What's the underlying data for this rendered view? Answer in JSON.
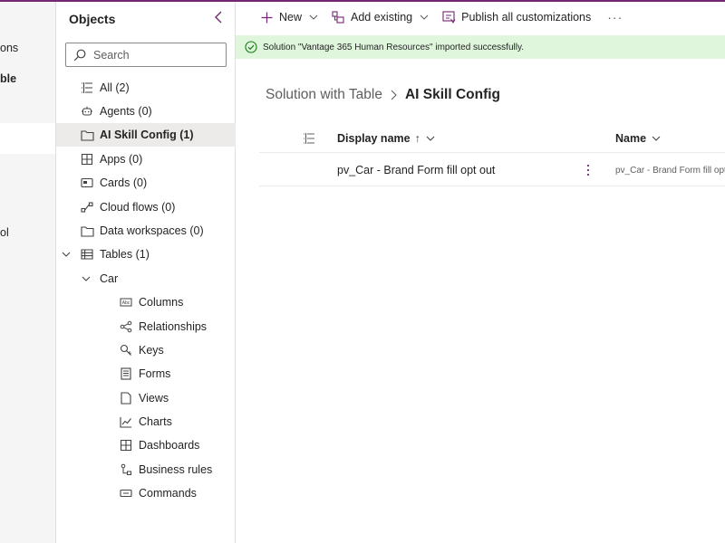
{
  "left_nav": {
    "items": [
      {
        "label": "ons",
        "bold": false
      },
      {
        "label": "ble",
        "bold": true
      },
      {
        "label": "ol",
        "bold": false
      }
    ]
  },
  "objects": {
    "title": "Objects",
    "search_placeholder": "Search",
    "items": [
      {
        "label": "All",
        "count": "(2)",
        "icon": "list-icon"
      },
      {
        "label": "Agents",
        "count": "(0)",
        "icon": "bot-icon"
      },
      {
        "label": "AI Skill Config",
        "count": "(1)",
        "icon": "folder-icon",
        "selected": true
      },
      {
        "label": "Apps",
        "count": "(0)",
        "icon": "apps-icon"
      },
      {
        "label": "Cards",
        "count": "(0)",
        "icon": "card-icon"
      },
      {
        "label": "Cloud flows",
        "count": "(0)",
        "icon": "flow-icon"
      },
      {
        "label": "Data workspaces",
        "count": "(0)",
        "icon": "folder-icon"
      },
      {
        "label": "Tables",
        "count": "(1)",
        "icon": "table-icon",
        "expanded": true
      },
      {
        "label": "Car",
        "count": "",
        "icon": "",
        "expanded": true
      }
    ],
    "car_children": [
      {
        "label": "Columns",
        "icon": "columns-icon"
      },
      {
        "label": "Relationships",
        "icon": "relationships-icon"
      },
      {
        "label": "Keys",
        "icon": "key-icon"
      },
      {
        "label": "Forms",
        "icon": "form-icon"
      },
      {
        "label": "Views",
        "icon": "view-icon"
      },
      {
        "label": "Charts",
        "icon": "chart-icon"
      },
      {
        "label": "Dashboards",
        "icon": "dashboard-icon"
      },
      {
        "label": "Business rules",
        "icon": "business-rules-icon"
      },
      {
        "label": "Commands",
        "icon": "command-icon"
      }
    ]
  },
  "toolbar": {
    "new_label": "New",
    "add_existing_label": "Add existing",
    "publish_label": "Publish all customizations",
    "more_label": "···"
  },
  "banner": {
    "text": "Solution \"Vantage 365 Human Resources\" imported successfully.",
    "status_color": "#107c10"
  },
  "breadcrumb": {
    "parent": "Solution with Table",
    "current": "AI Skill Config"
  },
  "grid": {
    "columns": {
      "display_name": "Display name",
      "sort_indicator": "↑",
      "name": "Name"
    },
    "rows": [
      {
        "display_name": "pv_Car - Brand Form fill opt out",
        "name": "pv_Car - Brand Form fill opt"
      }
    ]
  },
  "colors": {
    "accent": "#742774",
    "selected_bg": "#edebe9",
    "banner_bg": "#dff6dd"
  }
}
